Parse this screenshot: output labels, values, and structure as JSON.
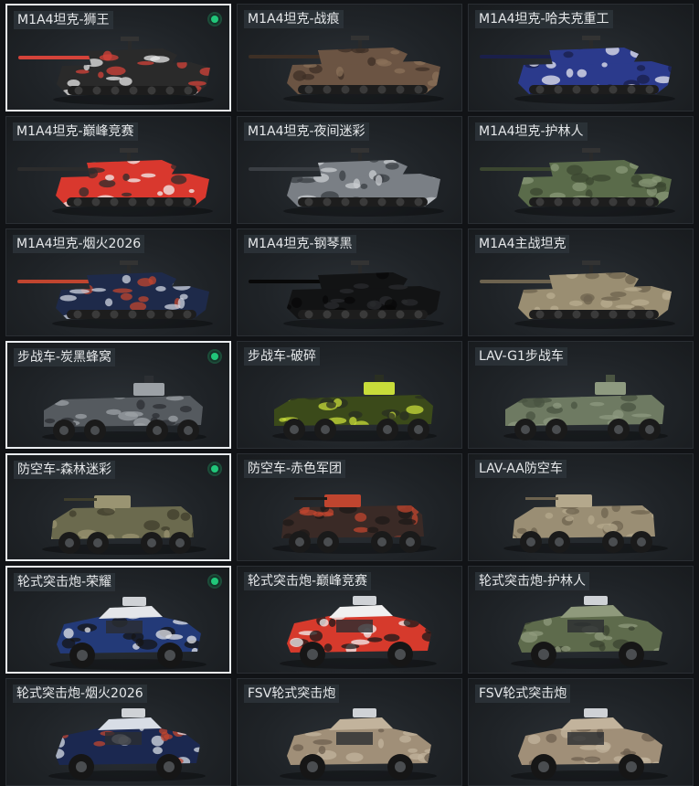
{
  "skins": [
    {
      "label": "M1A4坦克-狮王",
      "vehicle": "tank",
      "selected": true,
      "equipped": true,
      "colors": [
        "#2a2a2a",
        "#e8e8e8",
        "#d4433a"
      ]
    },
    {
      "label": "M1A4坦克-战痕",
      "vehicle": "tank",
      "selected": false,
      "equipped": false,
      "colors": [
        "#6b5443",
        "#8a7058",
        "#3d2f25"
      ]
    },
    {
      "label": "M1A4坦克-哈夫克重工",
      "vehicle": "tank",
      "selected": false,
      "equipped": false,
      "colors": [
        "#2b3a8c",
        "#e8e8f0",
        "#1a1f4a"
      ]
    },
    {
      "label": "M1A4坦克-巅峰竞赛",
      "vehicle": "tank",
      "selected": false,
      "equipped": false,
      "colors": [
        "#d9382e",
        "#f0f0f0",
        "#2c2c2c"
      ]
    },
    {
      "label": "M1A4坦克-夜间迷彩",
      "vehicle": "tank",
      "selected": false,
      "equipped": false,
      "colors": [
        "#7a7f85",
        "#c9ccd0",
        "#3a3e43"
      ]
    },
    {
      "label": "M1A4坦克-护林人",
      "vehicle": "tank",
      "selected": false,
      "equipped": false,
      "colors": [
        "#5a6b4a",
        "#8a9878",
        "#3b4630"
      ]
    },
    {
      "label": "M1A4坦克-烟火2026",
      "vehicle": "tank",
      "selected": false,
      "equipped": false,
      "colors": [
        "#1e2a4a",
        "#cfd4e0",
        "#c0452f"
      ]
    },
    {
      "label": "M1A4坦克-钢琴黑",
      "vehicle": "tank",
      "selected": false,
      "equipped": false,
      "colors": [
        "#121314",
        "#2a2b2d",
        "#080808"
      ]
    },
    {
      "label": "M1A4主战坦克",
      "vehicle": "tank",
      "selected": false,
      "equipped": false,
      "colors": [
        "#9a8e72",
        "#b8ac90",
        "#6d634f"
      ]
    },
    {
      "label": "步战车-炭黑蜂窝",
      "vehicle": "ifv",
      "selected": true,
      "equipped": true,
      "colors": [
        "#555a5f",
        "#9ca1a6",
        "#2c2f33"
      ]
    },
    {
      "label": "步战车-破碎",
      "vehicle": "ifv",
      "selected": false,
      "equipped": false,
      "colors": [
        "#3b4a1a",
        "#c8dc3a",
        "#2a2f22"
      ]
    },
    {
      "label": "LAV-G1步战车",
      "vehicle": "ifv",
      "selected": false,
      "equipped": false,
      "colors": [
        "#6e7a62",
        "#8e9a80",
        "#4a5442"
      ]
    },
    {
      "label": "防空车-森林迷彩",
      "vehicle": "aa",
      "selected": true,
      "equipped": true,
      "colors": [
        "#6b6a4e",
        "#9a9472",
        "#3f3e2c"
      ]
    },
    {
      "label": "防空车-赤色军团",
      "vehicle": "aa",
      "selected": false,
      "equipped": false,
      "colors": [
        "#3a2a26",
        "#c0452f",
        "#1e1a18"
      ]
    },
    {
      "label": "LAV-AA防空车",
      "vehicle": "aa",
      "selected": false,
      "equipped": false,
      "colors": [
        "#9a8e74",
        "#b4a88c",
        "#6d634f"
      ]
    },
    {
      "label": "轮式突击炮-荣耀",
      "vehicle": "wheeled",
      "selected": true,
      "equipped": true,
      "colors": [
        "#233a78",
        "#e4e6ea",
        "#151515"
      ]
    },
    {
      "label": "轮式突击炮-巅峰竞赛",
      "vehicle": "wheeled",
      "selected": false,
      "equipped": false,
      "colors": [
        "#d63a2c",
        "#f0f0f0",
        "#1a1a1a"
      ]
    },
    {
      "label": "轮式突击炮-护林人",
      "vehicle": "wheeled",
      "selected": false,
      "equipped": false,
      "colors": [
        "#5e6b4c",
        "#8f9a7c",
        "#3b4330"
      ]
    },
    {
      "label": "轮式突击炮-烟火2026",
      "vehicle": "wheeled",
      "selected": false,
      "equipped": false,
      "colors": [
        "#1b2850",
        "#d8dde6",
        "#c0452f"
      ]
    },
    {
      "label": "FSV轮式突击炮",
      "vehicle": "wheeled",
      "selected": false,
      "equipped": false,
      "colors": [
        "#a08f78",
        "#c2b39c",
        "#6d5f4f"
      ]
    },
    {
      "label": "FSV轮式突击炮",
      "vehicle": "wheeled",
      "selected": false,
      "equipped": false,
      "colors": [
        "#a08f78",
        "#c2b39c",
        "#6d5f4f"
      ]
    }
  ]
}
